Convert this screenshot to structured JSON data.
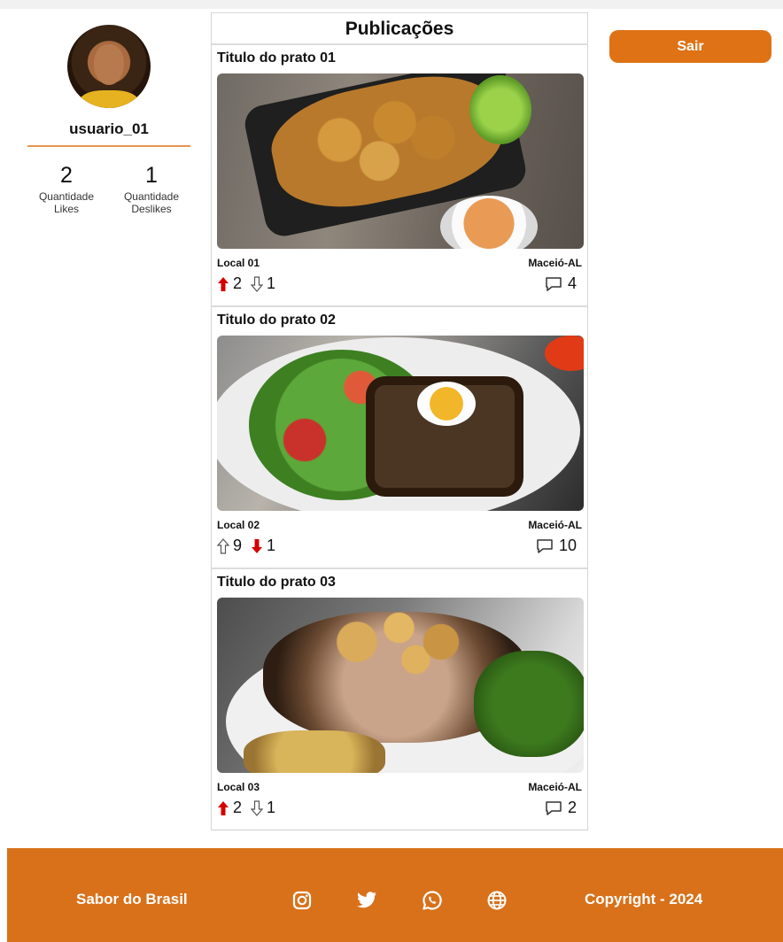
{
  "profile": {
    "username": "usuario_01",
    "likes_count": "2",
    "likes_label_1": "Quantidade",
    "likes_label_2": "Likes",
    "dislikes_count": "1",
    "dislikes_label_1": "Quantidade",
    "dislikes_label_2": "Deslikes"
  },
  "feed": {
    "title": "Publicações",
    "posts": [
      {
        "title": "Titulo do prato 01",
        "local": "Local 01",
        "city": "Maceió-AL",
        "up": "2",
        "down": "1",
        "comments": "4",
        "up_active": true,
        "down_active": false,
        "image": "fried-fish-photo"
      },
      {
        "title": "Titulo do prato 02",
        "local": "Local 02",
        "city": "Maceió-AL",
        "up": "9",
        "down": "1",
        "comments": "10",
        "up_active": false,
        "down_active": true,
        "image": "meatloaf-salad-photo"
      },
      {
        "title": "Titulo do prato 03",
        "local": "Local 03",
        "city": "Maceió-AL",
        "up": "2",
        "down": "1",
        "comments": "2",
        "up_active": true,
        "down_active": false,
        "image": "pork-chop-photo"
      }
    ]
  },
  "header": {
    "logout_label": "Sair"
  },
  "footer": {
    "brand": "Sabor do Brasil",
    "copyright": "Copyright - 2024",
    "icons": [
      "instagram-icon",
      "twitter-icon",
      "whatsapp-icon",
      "globe-icon"
    ]
  },
  "colors": {
    "accent": "#de7215",
    "footer_bg": "#d8711a",
    "vote_active": "#d40000",
    "divider": "#e8954d"
  }
}
